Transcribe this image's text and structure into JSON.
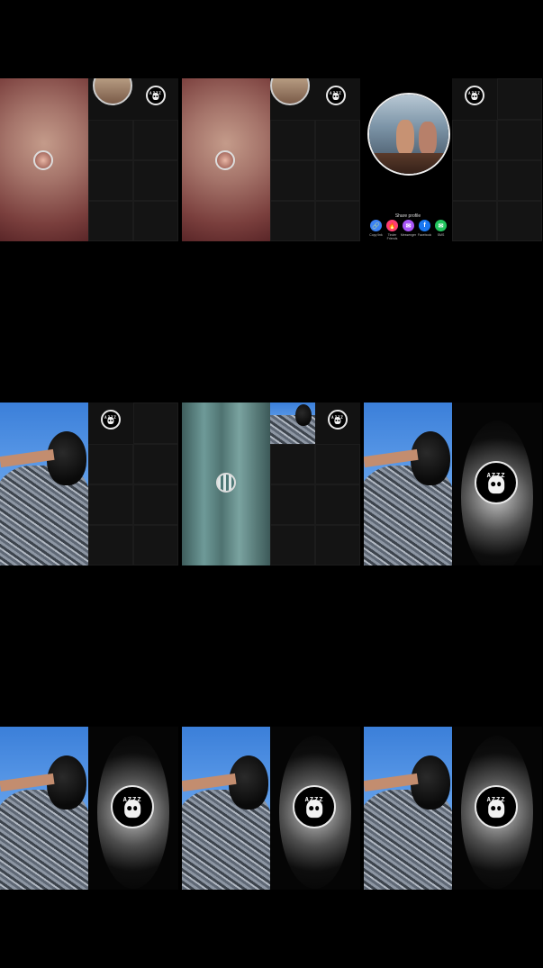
{
  "share_profile": {
    "title": "Share profile",
    "options": [
      {
        "label": "Copy link",
        "icon": "link-icon",
        "color": "#3b82f6",
        "glyph": "🔗"
      },
      {
        "label": "Tinder Friends",
        "icon": "tinder-icon",
        "color": "#fe3c72",
        "glyph": "🔥"
      },
      {
        "label": "Messenger",
        "icon": "messenger-icon",
        "color": "#a855f7",
        "glyph": "✉"
      },
      {
        "label": "Facebook",
        "icon": "facebook-icon",
        "color": "#1877f2",
        "glyph": "f"
      },
      {
        "label": "SMS",
        "icon": "message-icon",
        "color": "#22c55e",
        "glyph": "✉"
      }
    ]
  },
  "badge_text": "AZZZ",
  "colors": {
    "background": "#000000",
    "panel": "#121212"
  }
}
